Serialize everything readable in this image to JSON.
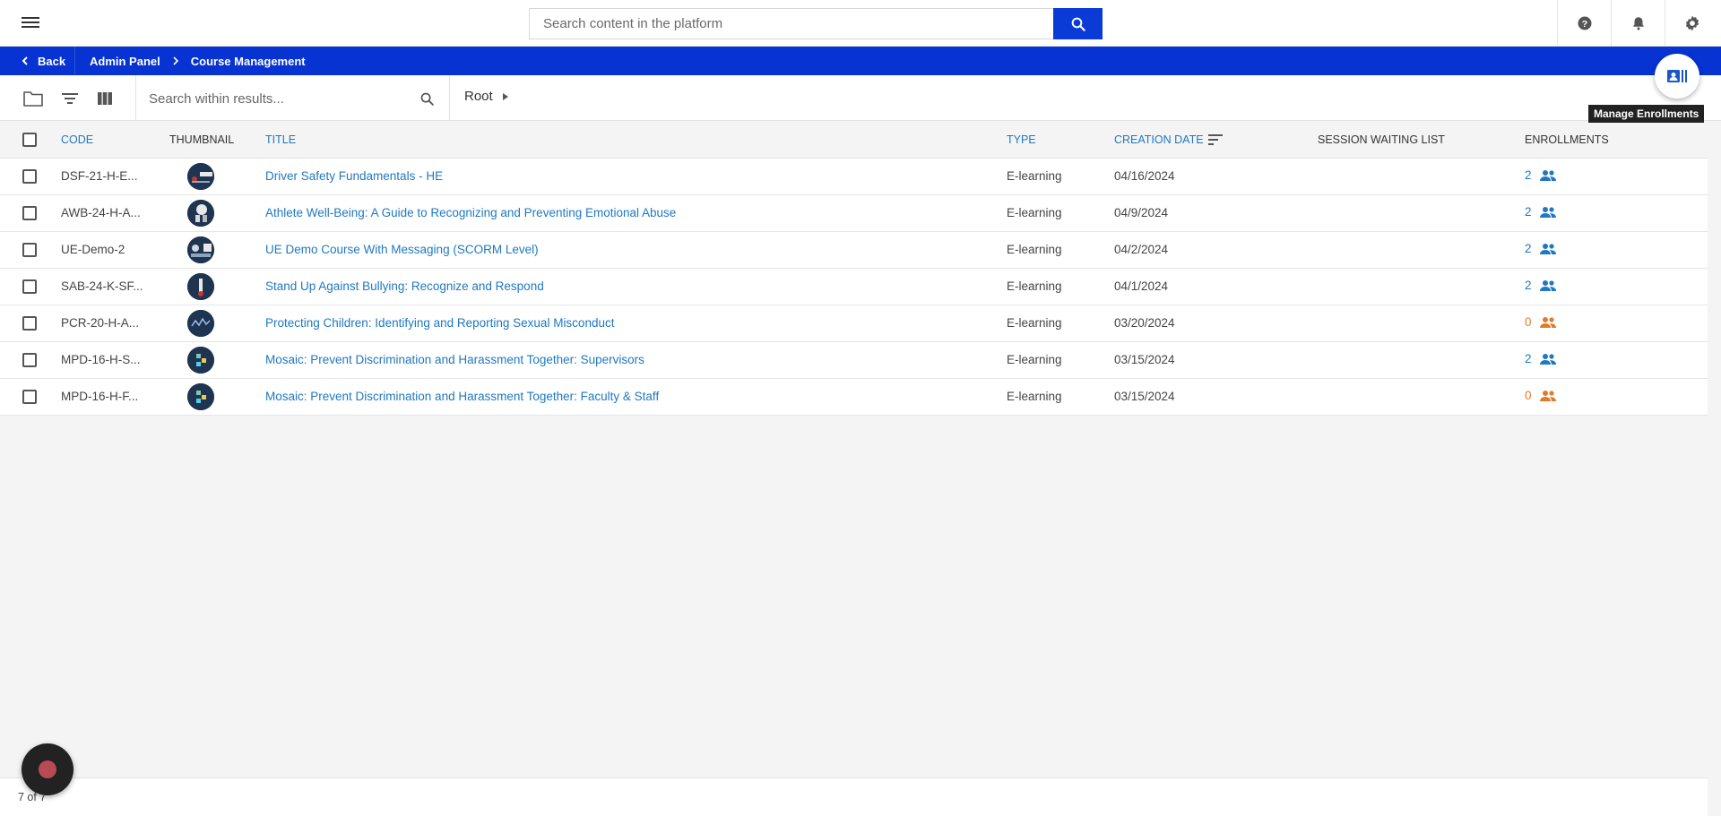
{
  "header": {
    "search_placeholder": "Search content in the platform"
  },
  "nav": {
    "back_label": "Back",
    "breadcrumb": [
      "Admin Panel",
      "Course Management"
    ]
  },
  "floating": {
    "manage_enrollments_tooltip": "Manage Enrollments"
  },
  "toolbar": {
    "search_placeholder": "Search within results...",
    "folder_crumb": "Root"
  },
  "table": {
    "columns": {
      "code": "CODE",
      "thumbnail": "THUMBNAIL",
      "title": "TITLE",
      "type": "TYPE",
      "creation_date": "CREATION DATE",
      "session_waiting_list": "SESSION WAITING LIST",
      "enrollments": "ENROLLMENTS"
    },
    "rows": [
      {
        "code": "DSF-21-H-E...",
        "title": "Driver Safety Fundamentals - HE",
        "type": "E-learning",
        "date": "04/16/2024",
        "enrollments": "2",
        "status": "active"
      },
      {
        "code": "AWB-24-H-A...",
        "title": "Athlete Well-Being: A Guide to Recognizing and Preventing Emotional Abuse",
        "type": "E-learning",
        "date": "04/9/2024",
        "enrollments": "2",
        "status": "active"
      },
      {
        "code": "UE-Demo-2",
        "title": "UE Demo Course With Messaging (SCORM Level)",
        "type": "E-learning",
        "date": "04/2/2024",
        "enrollments": "2",
        "status": "active"
      },
      {
        "code": "SAB-24-K-SF...",
        "title": "Stand Up Against Bullying: Recognize and Respond",
        "type": "E-learning",
        "date": "04/1/2024",
        "enrollments": "2",
        "status": "active"
      },
      {
        "code": "PCR-20-H-A...",
        "title": "Protecting Children: Identifying and Reporting Sexual Misconduct",
        "type": "E-learning",
        "date": "03/20/2024",
        "enrollments": "0",
        "status": "empty"
      },
      {
        "code": "MPD-16-H-S...",
        "title": "Mosaic: Prevent Discrimination and Harassment Together: Supervisors",
        "type": "E-learning",
        "date": "03/15/2024",
        "enrollments": "2",
        "status": "active"
      },
      {
        "code": "MPD-16-H-F...",
        "title": "Mosaic: Prevent Discrimination and Harassment Together: Faculty & Staff",
        "type": "E-learning",
        "date": "03/15/2024",
        "enrollments": "0",
        "status": "empty"
      }
    ]
  },
  "footer": {
    "count": "7 of 7"
  },
  "colors": {
    "brand_blue": "#0633d1",
    "link_blue": "#1f78c1",
    "enroll_active": "#1f78c1",
    "enroll_empty": "#e07b2c"
  }
}
